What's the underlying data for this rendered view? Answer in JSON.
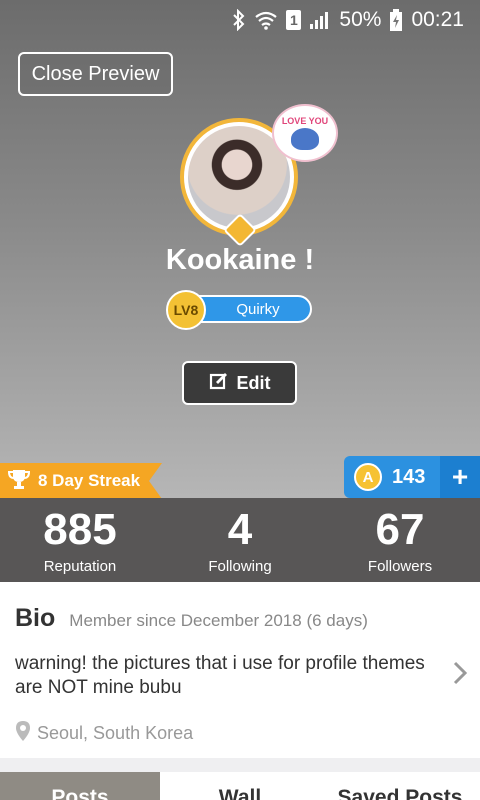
{
  "status_bar": {
    "battery_percent": "50%",
    "time": "00:21",
    "sim_slot": "1",
    "icons": [
      "bluetooth-icon",
      "wifi-icon",
      "signal-icon",
      "battery-charging-icon"
    ]
  },
  "header": {
    "close_preview_label": "Close Preview",
    "sticker_text": "LOVE YOU"
  },
  "profile": {
    "username": "Kookaine !",
    "level_label": "LV8",
    "level_title": "Quirky",
    "edit_label": "Edit"
  },
  "streak": {
    "label": "8 Day Streak"
  },
  "coins": {
    "count": "143",
    "plus": "+"
  },
  "stats": [
    {
      "value": "885",
      "label": "Reputation"
    },
    {
      "value": "4",
      "label": "Following"
    },
    {
      "value": "67",
      "label": "Followers"
    }
  ],
  "bio": {
    "title": "Bio",
    "member_since": "Member since December 2018 (6 days)",
    "text": "warning! the pictures that i use for profile themes are NOT mine bubu",
    "location": "Seoul, South Korea"
  },
  "tabs": [
    {
      "label": "Posts",
      "active": true
    },
    {
      "label": "Wall",
      "active": false
    },
    {
      "label": "Saved Posts",
      "active": false
    }
  ],
  "colors": {
    "accent_orange": "#f5a623",
    "accent_blue": "#2c91e0",
    "stats_bg": "#585656"
  }
}
